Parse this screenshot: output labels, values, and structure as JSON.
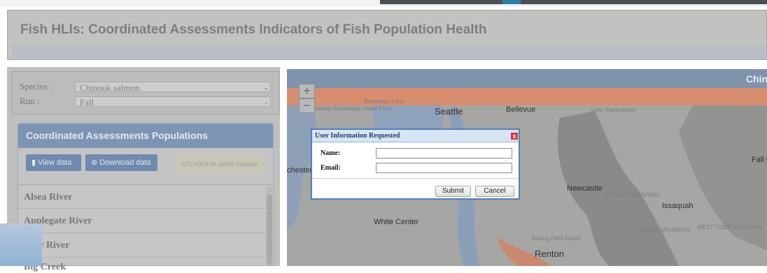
{
  "header": {
    "title": "Fish HLIs: Coordinated Assessments Indicators of Fish Population Health"
  },
  "selectors": {
    "species_label": "Species :",
    "species_value": "Chinook salmon",
    "run_label": "Run :",
    "run_value": "Fall"
  },
  "cap_panel": {
    "title": "Coordinated Assessments Populations",
    "view_label": "View data",
    "download_label": "Download data",
    "hint": "CTL+click to select multiple"
  },
  "populations": [
    "Alsea River",
    "Applegate River",
    "Bear River",
    "Big Creek"
  ],
  "map": {
    "title": "Chinook",
    "labels": {
      "seattle": "Seattle",
      "bellevue": "Bellevue",
      "newcastle": "Newcastle",
      "issaquah": "Issaquah",
      "white_center": "White Center",
      "renton": "Renton",
      "fall_city": "Fall C",
      "chester": "chester",
      "airport": "Boeing Field Airport",
      "ferry1": "Seattle-Bainbridge Island Ferry",
      "ferry2": "Bremerton Ferry",
      "cougar": "COUGAR MOUNTAIN",
      "squak": "SQUAK MOUNTAIN",
      "tiger": "WEST TIGER MOUNTAIN",
      "sammamish": "Lake Sammamish"
    }
  },
  "dialog": {
    "title": "User Information Requested",
    "close": "x",
    "name_label": "Name:",
    "email_label": "Email:",
    "submit": "Submit",
    "cancel": "Cancel"
  }
}
